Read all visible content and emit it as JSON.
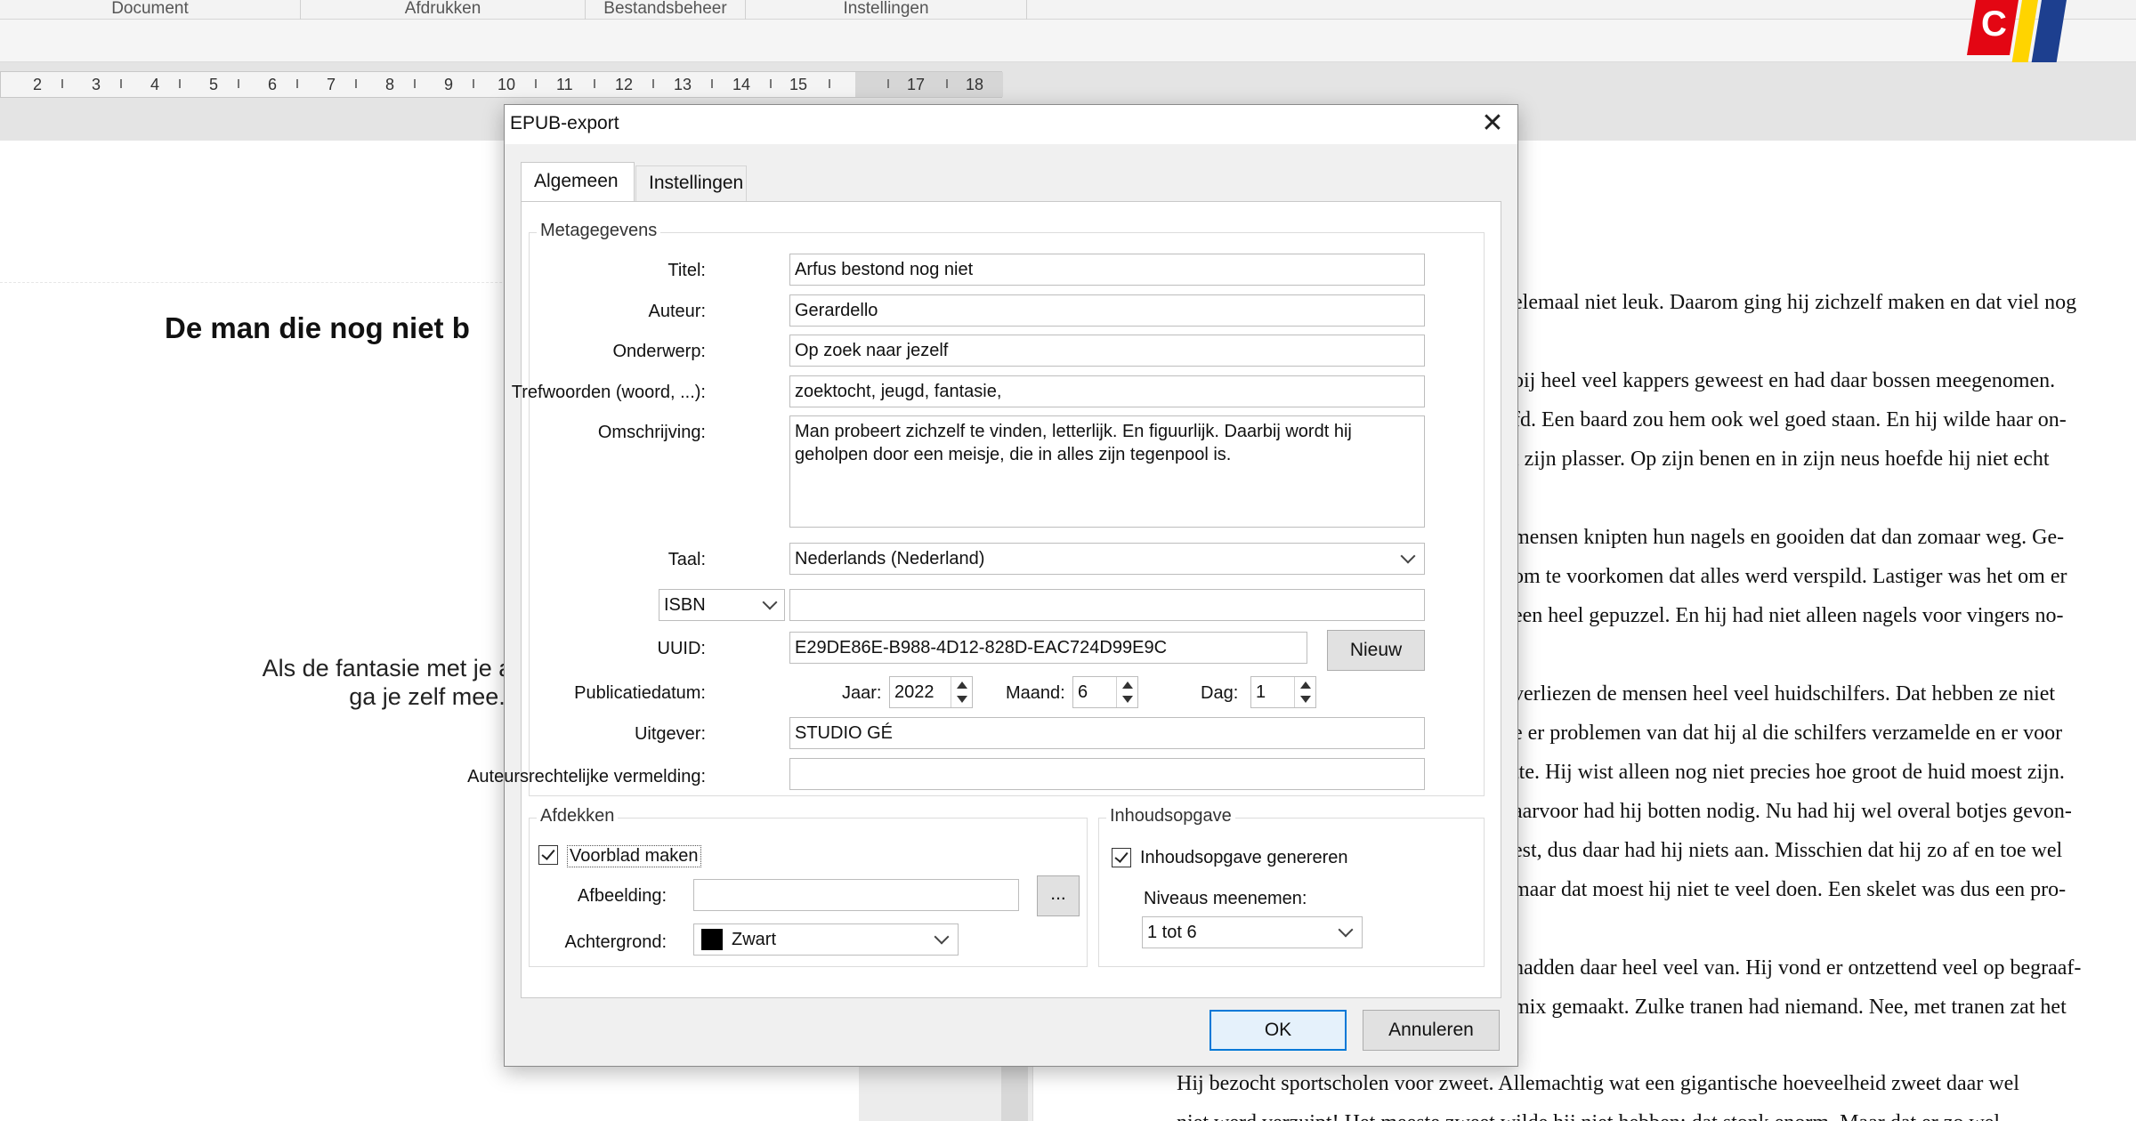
{
  "app": {
    "menus": [
      "Document",
      "Afdrukken",
      "Bestandsbeheer",
      "Instellingen"
    ],
    "ruler_numbers": [
      "2",
      "3",
      "4",
      "5",
      "6",
      "7",
      "8",
      "9",
      "10",
      "11",
      "12",
      "13",
      "14",
      "15",
      "17",
      "18"
    ]
  },
  "document": {
    "heading": "De man die nog niet b",
    "subtitle_line1": "Als de fantasie met je aan de h",
    "subtitle_line2": "ga je zelf mee.",
    "story_lines": [
      "elemaal niet leuk. Daarom ging hij zichzelf maken en dat viel nog",
      "",
      "bij heel veel kappers geweest en had daar bossen meegenomen.",
      "fd.  Een baard zou hem ook wel goed staan. En hij wilde haar on-",
      "l zijn plasser. Op zijn benen en in zijn neus hoefde hij niet echt",
      "",
      "mensen knipten hun nagels en gooiden dat dan zomaar weg. Ge-",
      "om te voorkomen dat alles werd verspild. Lastiger was het om er",
      "een heel gepuzzel. En hij had niet alleen nagels voor vingers no-",
      "",
      "verliezen de mensen heel veel huidschilfers. Dat hebben ze niet",
      "e er problemen van dat hij al die schilfers verzamelde en er voor",
      "tte. Hij wist alleen nog niet precies hoe groot de huid moest zijn.",
      "aarvoor had hij botten nodig. Nu had hij wel overal botjes gevon-",
      "est, dus daar had hij niets aan. Misschien dat hij zo af en toe wel",
      "maar dat moest hij niet te veel doen. Een skelet was dus een pro-",
      "",
      "hadden daar heel veel van. Hij vond er ontzettend veel op begraaf-",
      "mix gemaakt. Zulke tranen had niemand. Nee, met tranen zat het"
    ],
    "story_bottom": [
      "Hij bezocht sportscholen voor zweet. Allemachtig wat een gigantische hoeveelheid zweet daar wel",
      "niet werd verzuipt! Het meeste zweet wilde hij niet hebben: dat stonk enorm. Maar dat er zo wel"
    ]
  },
  "dialog": {
    "title": "EPUB-export",
    "close_label": "✕",
    "tabs": [
      {
        "label": "Algemeen",
        "active": true
      },
      {
        "label": "Instellingen",
        "active": false
      }
    ],
    "metadata": {
      "legend": "Metagegevens",
      "title_label": "Titel:",
      "title_value": "Arfus bestond nog niet",
      "author_label": "Auteur:",
      "author_value": "Gerardello",
      "subject_label": "Onderwerp:",
      "subject_value": "Op zoek naar jezelf",
      "keywords_label": "Trefwoorden (woord, ...):",
      "keywords_value": "zoektocht, jeugd, fantasie,",
      "description_label": "Omschrijving:",
      "description_value": "Man probeert zichzelf te vinden, letterlijk. En figuurlijk. Daarbij wordt hij geholpen door een meisje, die in alles zijn tegenpool is.",
      "language_label": "Taal:",
      "language_value": "Nederlands (Nederland)",
      "identifier_type": "ISBN",
      "identifier_value": "",
      "uuid_label": "UUID:",
      "uuid_value": "E29DE86E-B988-4D12-828D-EAC724D99E9C",
      "new_button": "Nieuw",
      "pubdate_label": "Publicatiedatum:",
      "year_label": "Jaar:",
      "year_value": "2022",
      "month_label": "Maand:",
      "month_value": "6",
      "day_label": "Dag:",
      "day_value": "1",
      "publisher_label": "Uitgever:",
      "publisher_value": "STUDIO GÉ",
      "copyright_label": "Auteursrechtelijke vermelding:",
      "copyright_value": ""
    },
    "cover": {
      "legend": "Afdekken",
      "make_cover_label": "Voorblad maken",
      "make_cover_checked": true,
      "image_label": "Afbeelding:",
      "image_value": "",
      "browse_label": "...",
      "background_label": "Achtergrond:",
      "background_value": "Zwart",
      "background_color": "#000000"
    },
    "toc": {
      "legend": "Inhoudsopgave",
      "generate_label": "Inhoudsopgave genereren",
      "generate_checked": true,
      "levels_label": "Niveaus meenemen:",
      "levels_value": "1 tot 6"
    },
    "ok_label": "OK",
    "cancel_label": "Annuleren"
  },
  "colors": {
    "accent": "#0078d7",
    "logo_red": "#e30613",
    "logo_yellow": "#ffd400",
    "logo_blue": "#1d3f8f"
  }
}
